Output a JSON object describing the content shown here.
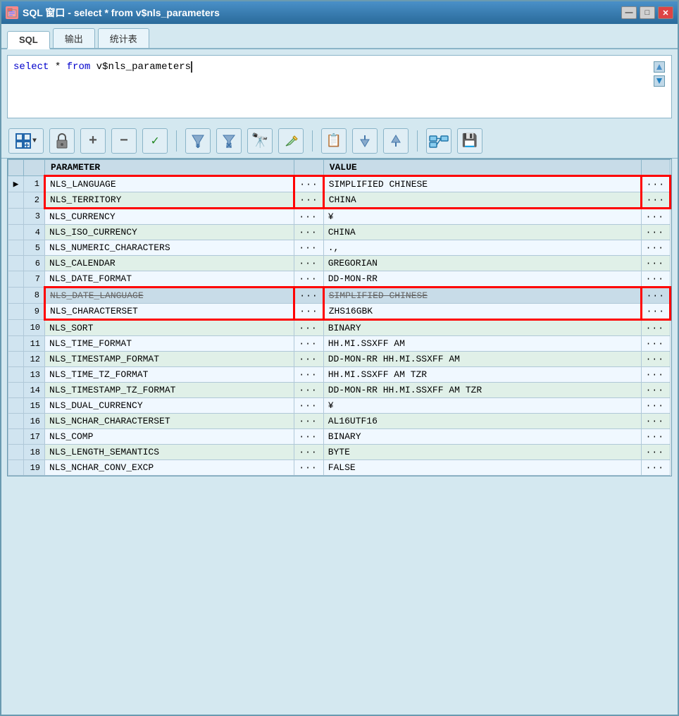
{
  "window": {
    "title": "SQL 窗口 - select * from v$nls_parameters",
    "icon": "🗄️",
    "buttons": {
      "minimize": "—",
      "restore": "□",
      "close": "✕"
    }
  },
  "tabs": [
    {
      "id": "sql",
      "label": "SQL",
      "active": true
    },
    {
      "id": "output",
      "label": "输出",
      "active": false
    },
    {
      "id": "stats",
      "label": "统计表",
      "active": false
    }
  ],
  "editor": {
    "content_keyword": "select * from",
    "content_normal": " v$nls_parameters",
    "scroll_up": "▲",
    "scroll_down": "▼"
  },
  "toolbar": {
    "grid_icon": "⊞",
    "lock_icon": "🔒",
    "add_icon": "+",
    "minus_icon": "−",
    "check_icon": "✓",
    "filter_down_icon": "▽",
    "filter_double_icon": "⏬",
    "binoculars_icon": "🔭",
    "edit_icon": "✏️",
    "copy_icon": "📋",
    "triangle_down": "▽",
    "triangle_up": "△",
    "connect_icon": "🔗",
    "save_icon": "💾"
  },
  "grid": {
    "columns": [
      {
        "id": "indicator",
        "label": ""
      },
      {
        "id": "rownum",
        "label": ""
      },
      {
        "id": "parameter",
        "label": "PARAMETER"
      },
      {
        "id": "dots1",
        "label": ""
      },
      {
        "id": "value",
        "label": "VALUE"
      },
      {
        "id": "dots2",
        "label": ""
      }
    ],
    "rows": [
      {
        "num": 1,
        "parameter": "NLS_LANGUAGE",
        "value": "SIMPLIFIED CHINESE",
        "highlight": "box1-top"
      },
      {
        "num": 2,
        "parameter": "NLS_TERRITORY",
        "value": "CHINA",
        "highlight": "box1-bottom"
      },
      {
        "num": 3,
        "parameter": "NLS_CURRENCY",
        "value": "¥",
        "highlight": ""
      },
      {
        "num": 4,
        "parameter": "NLS_ISO_CURRENCY",
        "value": "CHINA",
        "highlight": ""
      },
      {
        "num": 5,
        "parameter": "NLS_NUMERIC_CHARACTERS",
        "value": ".,",
        "highlight": ""
      },
      {
        "num": 6,
        "parameter": "NLS_CALENDAR",
        "value": "GREGORIAN",
        "highlight": ""
      },
      {
        "num": 7,
        "parameter": "NLS_DATE_FORMAT",
        "value": "DD-MON-RR",
        "highlight": ""
      },
      {
        "num": 8,
        "parameter": "NLS_DATE_LANGUAGE",
        "value": "SIMPLIFIED CHINESE",
        "highlight": "box2-top",
        "strikethrough": true
      },
      {
        "num": 9,
        "parameter": "NLS_CHARACTERSET",
        "value": "ZHS16GBK",
        "highlight": "box2-bottom"
      },
      {
        "num": 10,
        "parameter": "NLS_SORT",
        "value": "BINARY",
        "highlight": ""
      },
      {
        "num": 11,
        "parameter": "NLS_TIME_FORMAT",
        "value": "HH.MI.SSXFF AM",
        "highlight": ""
      },
      {
        "num": 12,
        "parameter": "NLS_TIMESTAMP_FORMAT",
        "value": "DD-MON-RR HH.MI.SSXFF AM",
        "highlight": ""
      },
      {
        "num": 13,
        "parameter": "NLS_TIME_TZ_FORMAT",
        "value": "HH.MI.SSXFF AM TZR",
        "highlight": ""
      },
      {
        "num": 14,
        "parameter": "NLS_TIMESTAMP_TZ_FORMAT",
        "value": "DD-MON-RR HH.MI.SSXFF AM TZR",
        "highlight": ""
      },
      {
        "num": 15,
        "parameter": "NLS_DUAL_CURRENCY",
        "value": "¥",
        "highlight": ""
      },
      {
        "num": 16,
        "parameter": "NLS_NCHAR_CHARACTERSET",
        "value": "AL16UTF16",
        "highlight": ""
      },
      {
        "num": 17,
        "parameter": "NLS_COMP",
        "value": "BINARY",
        "highlight": ""
      },
      {
        "num": 18,
        "parameter": "NLS_LENGTH_SEMANTICS",
        "value": "BYTE",
        "highlight": ""
      },
      {
        "num": 19,
        "parameter": "NLS_NCHAR_CONV_EXCP",
        "value": "FALSE",
        "highlight": ""
      }
    ]
  },
  "colors": {
    "title_bar_start": "#4a90c8",
    "title_bar_end": "#2a6a9a",
    "tab_active_bg": "#ffffff",
    "tab_inactive_bg": "#e8f4fa",
    "editor_bg": "#ffffff",
    "grid_header_bg": "#c8dce8",
    "row_even_bg": "#f0f8ff",
    "row_odd_bg": "#e0f0e8",
    "row_indicator_bg": "#d0e4f0",
    "highlight_red": "#ff0000"
  }
}
